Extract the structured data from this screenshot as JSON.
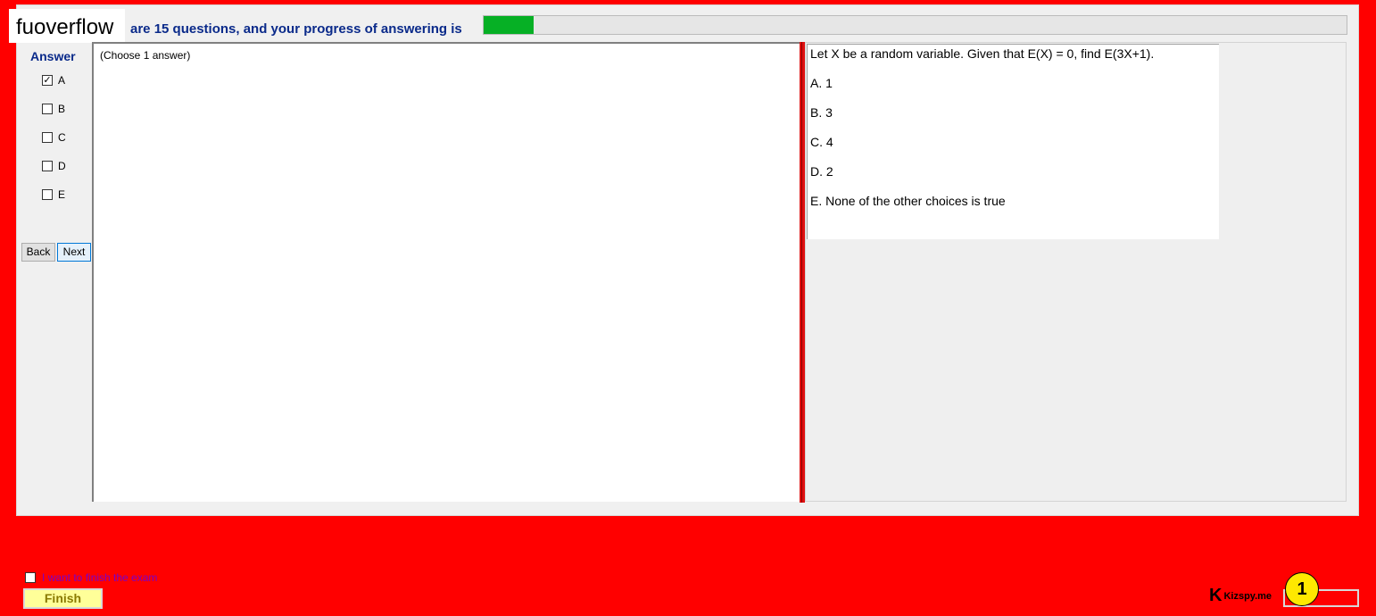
{
  "brand": "fuoverflow",
  "progress": {
    "text": "are 15 questions, and your progress of answering is",
    "fraction": 0.058
  },
  "answer": {
    "title": "Answer",
    "options": [
      {
        "label": "A",
        "checked": true
      },
      {
        "label": "B",
        "checked": false
      },
      {
        "label": "C",
        "checked": false
      },
      {
        "label": "D",
        "checked": false
      },
      {
        "label": "E",
        "checked": false
      }
    ]
  },
  "nav": {
    "back_label": "Back",
    "next_label": "Next"
  },
  "instruction": "(Choose 1 answer)",
  "question": {
    "text": "Let X be a random variable. Given that E(X) = 0, find E(3X+1).",
    "choices": [
      "A.  1",
      "B.  3",
      "C.  4",
      "D.  2",
      "E.  None of the other choices is true"
    ]
  },
  "finish": {
    "checkbox_label": "I want to finish the exam",
    "button_label": "Finish"
  },
  "watermark": "Kizspy.me",
  "badge": "1",
  "colors": {
    "background": "#ff0000",
    "progress_fill": "#06b025",
    "heading": "#0a2a8a"
  }
}
